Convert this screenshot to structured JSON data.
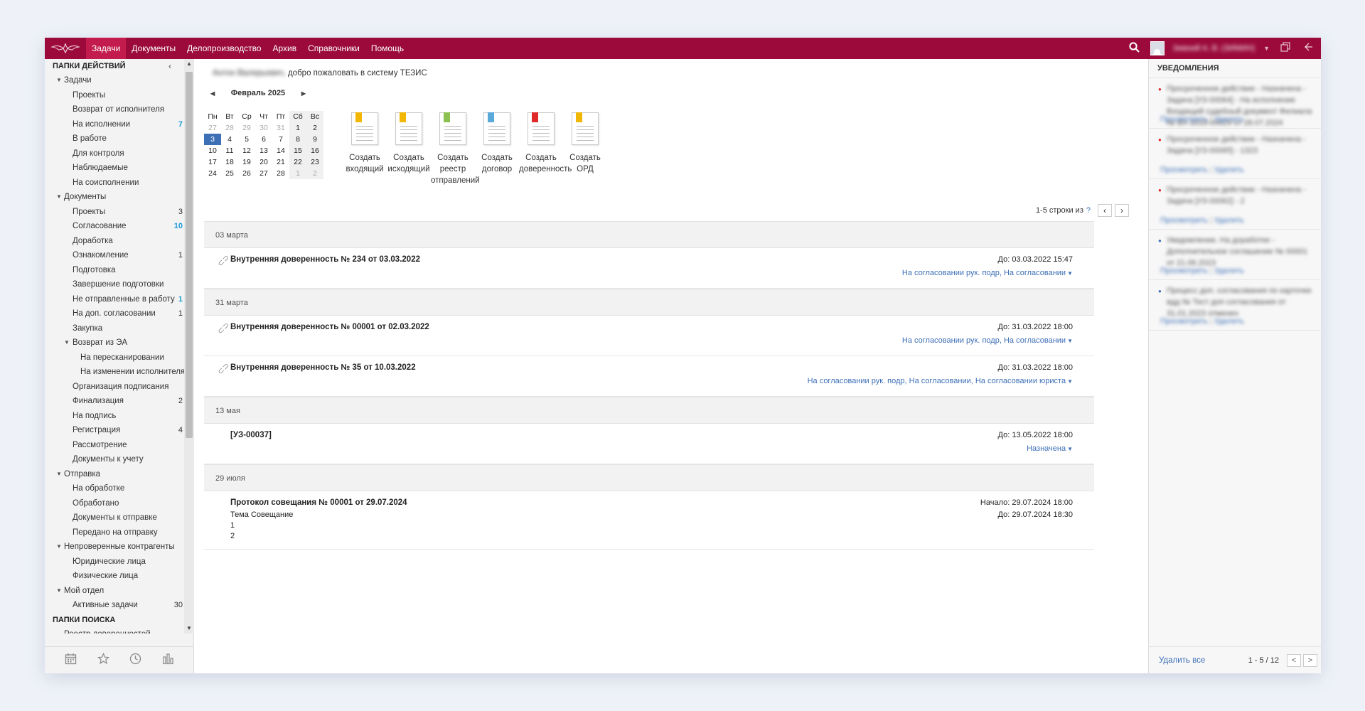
{
  "topbar": {
    "menu": [
      "Задачи",
      "Документы",
      "Делопроизводство",
      "Архив",
      "Справочники",
      "Помощь"
    ],
    "active_index": 0,
    "user_name": "Зимний А. В. (ЗИМИН)"
  },
  "sidebar": {
    "action_folders_title": "ПАПКИ ДЕЙСТВИЙ",
    "search_folders_title": "ПАПКИ ПОИСКА",
    "tree": [
      {
        "label": "Задачи",
        "level": 0,
        "toggle": "▼"
      },
      {
        "label": "Проекты",
        "level": 1
      },
      {
        "label": "Возврат от исполнителя",
        "level": 1
      },
      {
        "label": "На исполнении",
        "level": 1,
        "count": "7",
        "blue": true
      },
      {
        "label": "В работе",
        "level": 1
      },
      {
        "label": "Для контроля",
        "level": 1
      },
      {
        "label": "Наблюдаемые",
        "level": 1
      },
      {
        "label": "На соисполнении",
        "level": 1
      },
      {
        "label": "Документы",
        "level": 0,
        "toggle": "▼"
      },
      {
        "label": "Проекты",
        "level": 1,
        "count": "3"
      },
      {
        "label": "Согласование",
        "level": 1,
        "count": "10",
        "blue": true
      },
      {
        "label": "Доработка",
        "level": 1
      },
      {
        "label": "Ознакомление",
        "level": 1,
        "count": "1"
      },
      {
        "label": "Подготовка",
        "level": 1
      },
      {
        "label": "Завершение подготовки",
        "level": 1
      },
      {
        "label": "Не отправленные в работу",
        "level": 1,
        "count": "1",
        "blue": true
      },
      {
        "label": "На доп. согласовании",
        "level": 1,
        "count": "1"
      },
      {
        "label": "Закупка",
        "level": 1
      },
      {
        "label": "Возврат из ЭА",
        "level": 1,
        "toggle": "▼"
      },
      {
        "label": "На пересканировании",
        "level": 2
      },
      {
        "label": "На изменении исполнителя",
        "level": 2
      },
      {
        "label": "Организация подписания",
        "level": 1
      },
      {
        "label": "Финализация",
        "level": 1,
        "count": "2"
      },
      {
        "label": "На подпись",
        "level": 1
      },
      {
        "label": "Регистрация",
        "level": 1,
        "count": "4"
      },
      {
        "label": "Рассмотрение",
        "level": 1
      },
      {
        "label": "Документы к учету",
        "level": 1
      },
      {
        "label": "Отправка",
        "level": 0,
        "toggle": "▼"
      },
      {
        "label": "На обработке",
        "level": 1
      },
      {
        "label": "Обработано",
        "level": 1
      },
      {
        "label": "Документы к отправке",
        "level": 1
      },
      {
        "label": "Передано на отправку",
        "level": 1
      },
      {
        "label": "Непроверенные контрагенты",
        "level": 0,
        "toggle": "▼"
      },
      {
        "label": "Юридические лица",
        "level": 1
      },
      {
        "label": "Физические лица",
        "level": 1
      },
      {
        "label": "Мой отдел",
        "level": 0,
        "toggle": "▼"
      },
      {
        "label": "Активные задачи",
        "level": 1,
        "count": "30"
      }
    ],
    "search_items": [
      "Реестр доверенностей"
    ]
  },
  "main": {
    "welcome_user": "Антон Валерьевич,",
    "welcome_text": " добро пожаловать в систему ТЕЗИС",
    "calendar": {
      "month": "Февраль 2025",
      "weekdays": [
        "Пн",
        "Вт",
        "Ср",
        "Чт",
        "Пт",
        "Сб",
        "Вс"
      ],
      "weeks": [
        [
          "27",
          "28",
          "29",
          "30",
          "31",
          "1",
          "2"
        ],
        [
          "3",
          "4",
          "5",
          "6",
          "7",
          "8",
          "9"
        ],
        [
          "10",
          "11",
          "12",
          "13",
          "14",
          "15",
          "16"
        ],
        [
          "17",
          "18",
          "19",
          "20",
          "21",
          "22",
          "23"
        ],
        [
          "24",
          "25",
          "26",
          "27",
          "28",
          "1",
          "2"
        ]
      ],
      "today": "3"
    },
    "quick_actions": [
      {
        "label": "Создать входящий",
        "color": "#f2b705"
      },
      {
        "label": "Создать исходящий",
        "color": "#f2b705"
      },
      {
        "label": "Создать реестр отправлений",
        "color": "#8cc152"
      },
      {
        "label": "Создать договор",
        "color": "#5aa9d8"
      },
      {
        "label": "Создать доверенность",
        "color": "#e02a2a"
      },
      {
        "label": "Создать ОРД",
        "color": "#f2b705"
      }
    ],
    "pager_label": "1-5 строки из",
    "pager_help": "?",
    "groups": [
      {
        "date": "03 марта",
        "entries": [
          {
            "title": "Внутренняя доверенность № 234 от 03.03.2022",
            "due": "До: 03.03.2022 15:47",
            "status": "На согласовании рук. подр, На согласовании",
            "clip": true
          }
        ]
      },
      {
        "date": "31 марта",
        "entries": [
          {
            "title": "Внутренняя доверенность № 00001 от 02.03.2022",
            "due": "До: 31.03.2022 18:00",
            "status": "На согласовании рук. подр, На согласовании",
            "clip": true
          },
          {
            "title": "Внутренняя доверенность № 35 от 10.03.2022",
            "due": "До: 31.03.2022 18:00",
            "status": "На согласовании рук. подр, На согласовании, На согласовании юриста",
            "clip": true
          }
        ]
      },
      {
        "date": "13 мая",
        "entries": [
          {
            "title": "[УЗ-00037]",
            "due": "До: 13.05.2022 18:00",
            "status": "Назначена",
            "clip": false
          }
        ]
      },
      {
        "date": "29 июля",
        "entries": [
          {
            "title": "Протокол совещания № 00001 от 29.07.2024",
            "start": "Начало: 29.07.2024 18:00",
            "due": "До: 29.07.2024 18:30",
            "subject": "Тема Совещание",
            "lines": [
              "1",
              "2"
            ],
            "clip": false
          }
        ]
      }
    ]
  },
  "notifications": {
    "title": "УВЕДОМЛЕНИЯ",
    "items": [
      {
        "text": "Просроченное действие - Назначена - Задача [УЗ-00064] - На исполнение Входящий судебный документ Филиала № ВХ-3333-00029 от 28.07.2024",
        "dot": "#e02a2a"
      },
      {
        "text": "Просроченное действие - Назначена - Задача [УЗ-00065] - 1323",
        "dot": "#e02a2a"
      },
      {
        "text": "Просроченное действие - Назначена - Задача [УЗ-00062] - 2",
        "dot": "#e02a2a"
      },
      {
        "text": "Уведомление. На доработке - Дополнительное соглашение № 00001 от 21.06.2023",
        "dot": "#3d6fb6"
      },
      {
        "text": "Процесс доп. согласования по карточке вдд № Тест доп согласования от 31.01.2023 отменен",
        "dot": "#3d6fb6"
      }
    ],
    "view_label": "Просмотреть",
    "delete_label": "Удалить",
    "delete_all": "Удалить все",
    "range": "1 - 5 / 12"
  }
}
